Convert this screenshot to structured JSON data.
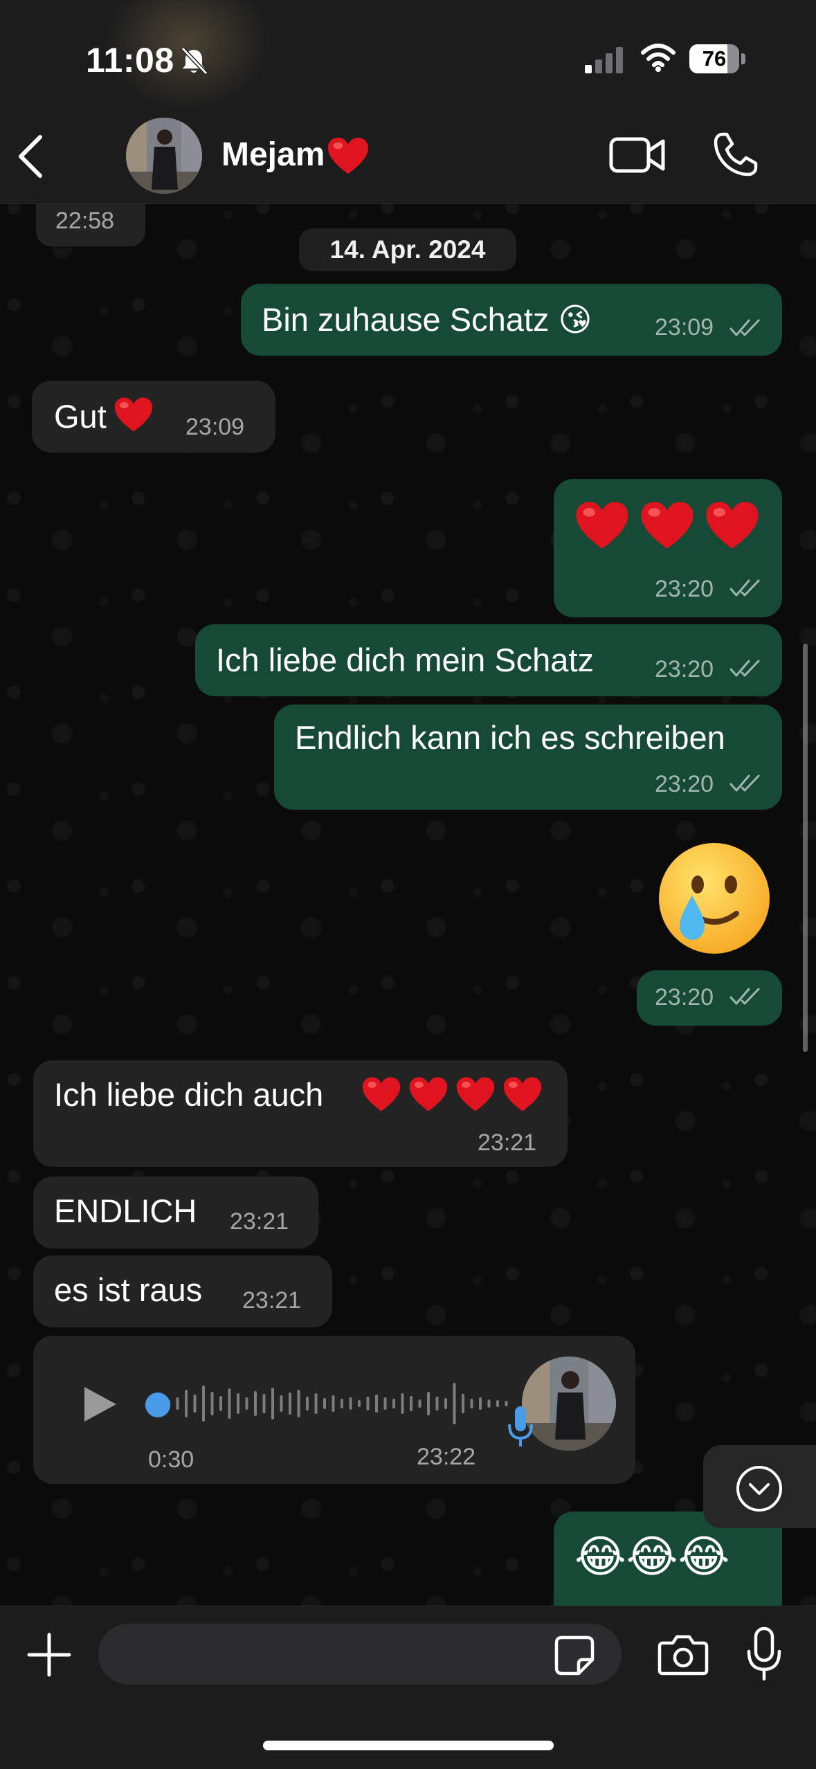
{
  "status_bar": {
    "time": "11:08",
    "battery": "76",
    "battery_level": 0.76
  },
  "header": {
    "contact_name": "Mejam",
    "name_emoji": "red-heart"
  },
  "chat": {
    "partial_time": "22:58",
    "date_separator": "14. Apr. 2024",
    "messages": [
      {
        "dir": "out",
        "text": "Bin zuhause Schatz 😘",
        "time": "23:09",
        "status": "read"
      },
      {
        "dir": "in",
        "text": "Gut",
        "emoji": "red-heart",
        "time": "23:09"
      },
      {
        "dir": "out",
        "emoji": "red-heart x3",
        "time": "23:20",
        "status": "read"
      },
      {
        "dir": "out",
        "text": "Ich liebe dich mein Schatz",
        "time": "23:20",
        "status": "read"
      },
      {
        "dir": "out",
        "text": "Endlich kann ich es schreiben",
        "time": "23:20",
        "status": "read"
      },
      {
        "dir": "out",
        "sticker": "😢",
        "time": "23:20",
        "status": "read"
      },
      {
        "dir": "in",
        "text": "Ich liebe dich auch",
        "emoji": "red-heart x4",
        "time": "23:21"
      },
      {
        "dir": "in",
        "text": "ENDLICH",
        "time": "23:21"
      },
      {
        "dir": "in",
        "text": "es ist raus",
        "time": "23:21"
      },
      {
        "dir": "in",
        "type": "voice",
        "duration": "0:30",
        "time": "23:22"
      },
      {
        "dir": "out",
        "text": "😂😂😂"
      }
    ]
  },
  "icons": [
    "back-icon",
    "video-call-icon",
    "phone-icon",
    "plus-icon",
    "sticker-icon",
    "camera-icon",
    "mic-icon",
    "play-icon",
    "scroll-down-icon"
  ],
  "colors": {
    "outgoing_bubble": "#164a37",
    "incoming_bubble": "#232323",
    "bar": "#1c1c1d",
    "voice_dot": "#4a9be8",
    "heart": "#e0141e"
  }
}
